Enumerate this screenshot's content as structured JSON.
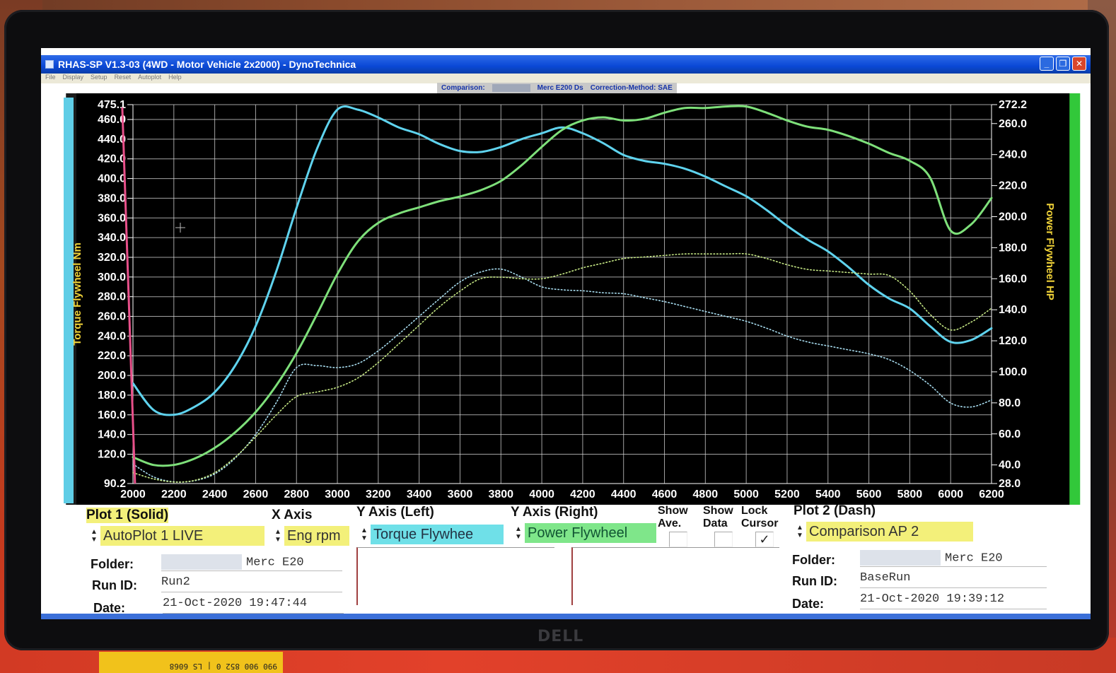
{
  "window": {
    "title": "RHAS-SP V1.3-03  (4WD - Motor Vehicle 2x2000) - DynoTechnica",
    "menu": [
      "File",
      "Display",
      "Setup",
      "Reset",
      "Autoplot",
      "Help"
    ],
    "comparison_label": "Comparison:",
    "comparison_vehicle": "Merc E200 Ds",
    "correction": "Correction-Method: SAE"
  },
  "monitor_brand": "DELL",
  "sticker_text": "990 900 852 0 | LS 6068",
  "chart_data": {
    "type": "line",
    "xlabel": "",
    "ylabel_left": "Torque Flywheel Nm",
    "ylabel_right": "Power Flywheel HP",
    "xlim": [
      2000,
      6200
    ],
    "ylim_left": [
      90.2,
      475.1
    ],
    "ylim_right": [
      28.0,
      272.2
    ],
    "x_ticks": [
      2000,
      2200,
      2400,
      2600,
      2800,
      3000,
      3200,
      3400,
      3600,
      3800,
      4000,
      4200,
      4400,
      4600,
      4800,
      5000,
      5200,
      5400,
      5600,
      5800,
      6000,
      6200
    ],
    "x_tick_labels": [
      "2000",
      "2200",
      "2400",
      "2600",
      "2800",
      "3000",
      "3200",
      "3400",
      "3600",
      "3800",
      "4000",
      "4200",
      "4400",
      "4600",
      "4800",
      "5000",
      "5200",
      "5400",
      "5600",
      "5800",
      "6000",
      "6200"
    ],
    "y_left_ticks": [
      90.2,
      120.0,
      140.0,
      160.0,
      180.0,
      200.0,
      220.0,
      240.0,
      260.0,
      280.0,
      300.0,
      320.0,
      340.0,
      360.0,
      380.0,
      400.0,
      420.0,
      440.0,
      460.0,
      475.1
    ],
    "y_left_tick_labels": [
      "90.2",
      "120.0",
      "140.0",
      "160.0",
      "180.0",
      "200.0",
      "220.0",
      "240.0",
      "260.0",
      "280.0",
      "300.0",
      "320.0",
      "340.0",
      "360.0",
      "380.0",
      "400.0",
      "420.0",
      "440.0",
      "460.0",
      "475.1"
    ],
    "y_right_ticks": [
      28.0,
      40.0,
      60.0,
      80.0,
      100.0,
      120.0,
      140.0,
      160.0,
      180.0,
      200.0,
      220.0,
      240.0,
      260.0,
      272.2
    ],
    "y_right_tick_labels": [
      "28.0",
      "40.0",
      "60.0",
      "80.0",
      "100.0",
      "120.0",
      "140.0",
      "160.0",
      "180.0",
      "200.0",
      "220.0",
      "240.0",
      "260.0",
      "272.2"
    ],
    "grid": true,
    "cursor_x": 2010,
    "series": [
      {
        "axis": "left",
        "style": "solid",
        "color": "#5fd3ee",
        "x": [
          2000,
          2100,
          2200,
          2300,
          2400,
          2500,
          2600,
          2700,
          2800,
          2900,
          3000,
          3100,
          3200,
          3300,
          3400,
          3500,
          3600,
          3700,
          3800,
          3900,
          4000,
          4100,
          4200,
          4300,
          4400,
          4500,
          4600,
          4700,
          4800,
          4900,
          5000,
          5100,
          5200,
          5300,
          5400,
          5500,
          5600,
          5700,
          5800,
          5900,
          6000,
          6100,
          6200
        ],
        "y": [
          192,
          165,
          160,
          168,
          183,
          210,
          250,
          305,
          370,
          430,
          470,
          470,
          462,
          452,
          445,
          435,
          428,
          427,
          432,
          440,
          446,
          452,
          446,
          436,
          424,
          418,
          415,
          410,
          402,
          392,
          382,
          368,
          352,
          338,
          326,
          310,
          292,
          278,
          268,
          250,
          234,
          236,
          248
        ]
      },
      {
        "axis": "right",
        "style": "solid",
        "color": "#7ee07a",
        "x": [
          2000,
          2100,
          2200,
          2300,
          2400,
          2500,
          2600,
          2700,
          2800,
          2900,
          3000,
          3100,
          3200,
          3300,
          3400,
          3500,
          3600,
          3700,
          3800,
          3900,
          4000,
          4100,
          4200,
          4300,
          4400,
          4500,
          4600,
          4700,
          4800,
          4900,
          5000,
          5100,
          5200,
          5300,
          5400,
          5500,
          5600,
          5700,
          5800,
          5900,
          6000,
          6100,
          6200
        ],
        "y": [
          45,
          40,
          40,
          44,
          51,
          61,
          74,
          91,
          112,
          137,
          163,
          184,
          196,
          202,
          206,
          210,
          213,
          217,
          223,
          233,
          245,
          256,
          262,
          264,
          262,
          263,
          267,
          270,
          270,
          271,
          271,
          267,
          262,
          258,
          256,
          252,
          247,
          241,
          236,
          225,
          191,
          195,
          212
        ]
      },
      {
        "axis": "left",
        "style": "dotted",
        "color": "#a8ddf0",
        "x": [
          2000,
          2100,
          2200,
          2300,
          2400,
          2500,
          2600,
          2700,
          2800,
          2900,
          3000,
          3100,
          3200,
          3300,
          3400,
          3500,
          3600,
          3700,
          3800,
          3900,
          4000,
          4100,
          4200,
          4300,
          4400,
          4500,
          4600,
          4700,
          4800,
          4900,
          5000,
          5100,
          5200,
          5300,
          5400,
          5500,
          5600,
          5700,
          5800,
          5900,
          6000,
          6100,
          6200
        ],
        "y": [
          110,
          97,
          92,
          93,
          100,
          116,
          140,
          172,
          208,
          210,
          208,
          212,
          225,
          242,
          260,
          278,
          295,
          305,
          308,
          300,
          290,
          287,
          286,
          284,
          283,
          279,
          275,
          270,
          265,
          260,
          255,
          248,
          240,
          234,
          230,
          226,
          222,
          216,
          205,
          190,
          172,
          168,
          175
        ]
      },
      {
        "axis": "right",
        "style": "dotted",
        "color": "#c6e884",
        "x": [
          2000,
          2100,
          2200,
          2300,
          2400,
          2500,
          2600,
          2700,
          2800,
          2900,
          3000,
          3100,
          3200,
          3300,
          3400,
          3500,
          3600,
          3700,
          3800,
          3900,
          4000,
          4100,
          4200,
          4300,
          4400,
          4500,
          4600,
          4700,
          4800,
          4900,
          5000,
          5100,
          5200,
          5300,
          5400,
          5500,
          5600,
          5700,
          5800,
          5900,
          6000,
          6100,
          6200
        ],
        "y": [
          35,
          31,
          29,
          30,
          35,
          45,
          58,
          72,
          84,
          87,
          90,
          96,
          106,
          118,
          130,
          142,
          152,
          160,
          161,
          160,
          160,
          163,
          167,
          170,
          173,
          174,
          175,
          176,
          176,
          176,
          176,
          173,
          169,
          166,
          165,
          164,
          163,
          162,
          152,
          137,
          127,
          132,
          141
        ]
      }
    ]
  },
  "panel": {
    "plot1": {
      "title": "Plot 1 (Solid)",
      "selection": "AutoPlot 1 LIVE"
    },
    "x_axis": {
      "title": "X Axis",
      "value": "Eng rpm"
    },
    "y_left": {
      "title": "Y Axis (Left)",
      "value": "Torque Flywhee"
    },
    "y_right": {
      "title": "Y Axis (Right)",
      "value": "Power Flywheel"
    },
    "show_ave": {
      "line1": "Show",
      "line2": "Ave."
    },
    "show_data": {
      "line1": "Show",
      "line2": "Data"
    },
    "lock_cursor": {
      "line1": "Lock",
      "line2": "Cursor",
      "checked": true
    },
    "plot2": {
      "title": "Plot 2 (Dash)",
      "selection": "Comparison AP 2"
    },
    "labels": {
      "folder": "Folder:",
      "run_id": "Run ID:",
      "date": "Date:"
    },
    "plot1_info": {
      "folder": "Merc E20",
      "run_id": "Run2",
      "date": "21-Oct-2020  19:47:44"
    },
    "plot2_info": {
      "folder": "Merc E20",
      "run_id": "BaseRun",
      "date": "21-Oct-2020  19:39:12"
    },
    "checkmark": "✓"
  },
  "colors": {
    "plot_bg": "#000000",
    "grid": "#d8d8d8",
    "torque_label": "#f0d238",
    "cursor": "#e8508a",
    "tick_text": "#ffffff"
  }
}
